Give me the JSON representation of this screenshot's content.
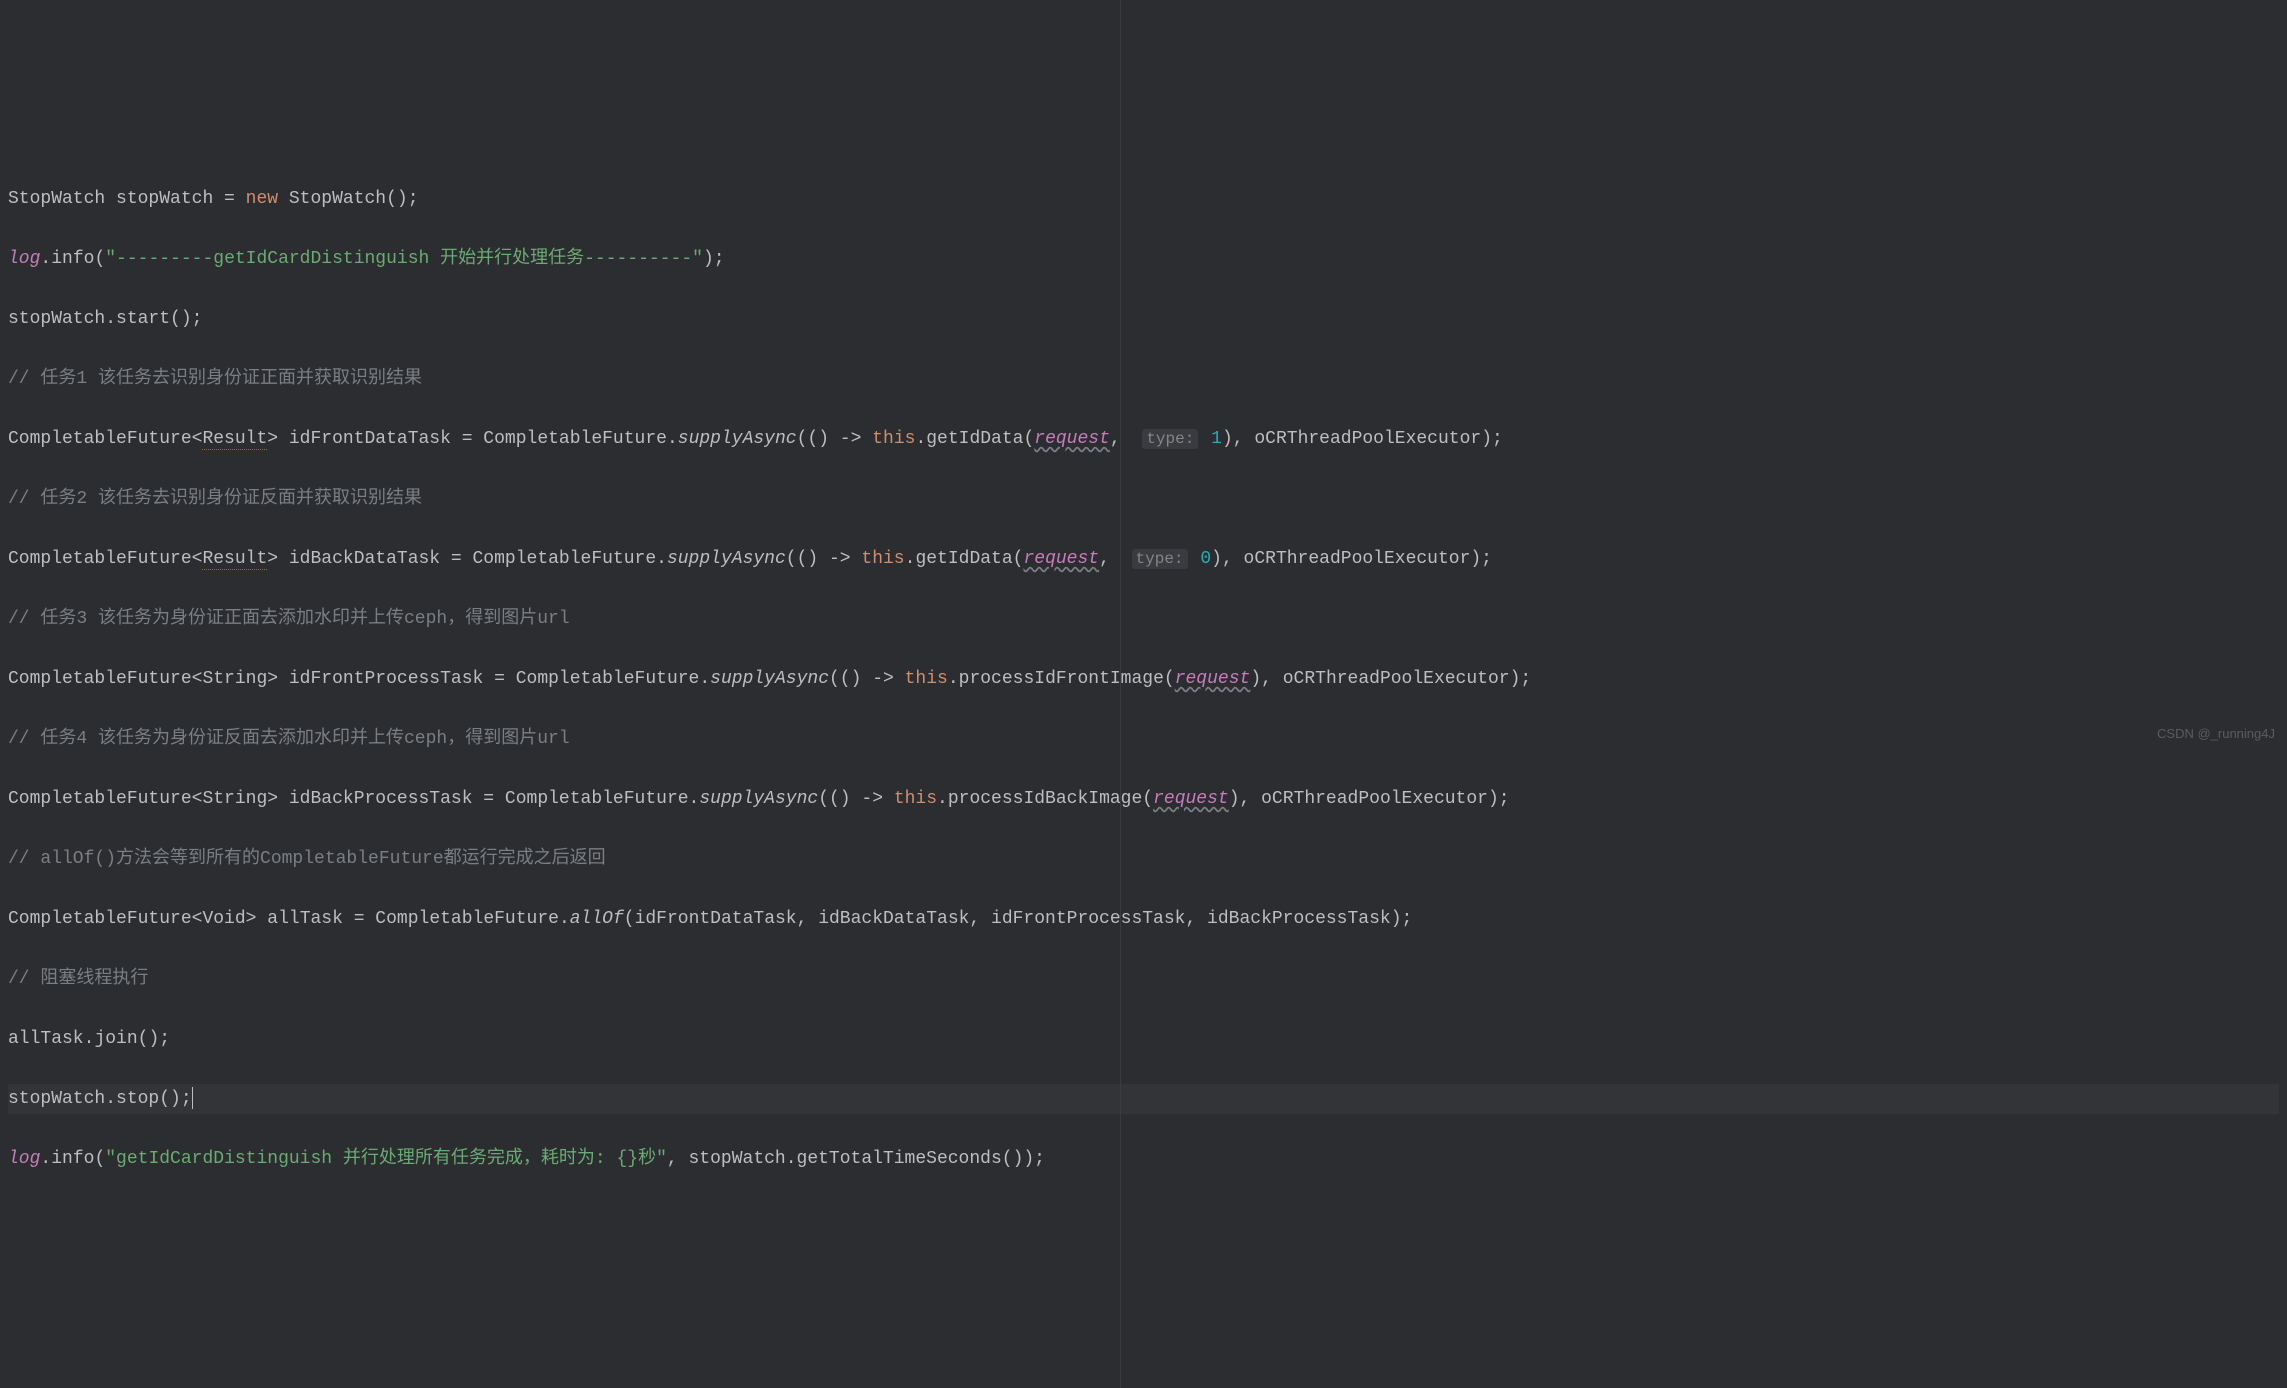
{
  "lines": {
    "l1": {
      "type1": "StopWatch",
      "var1": "stopWatch",
      "eq": " = ",
      "new": "new",
      "ctor": " StopWatch",
      "parens": "();"
    },
    "l2": {
      "log": "log",
      "dot": ".",
      "method": "info",
      "open": "(",
      "str": "\"---------getIdCardDistinguish 开始并行处理任务----------\"",
      "close": ");"
    },
    "l3": {
      "obj": "stopWatch",
      "dot": ".",
      "method": "start",
      "parens": "();"
    },
    "l4": {
      "comment": "// 任务1 该任务去识别身份证正面并获取识别结果"
    },
    "l5": {
      "type": "CompletableFuture",
      "lt": "<",
      "generic": "Result",
      "gt": ">",
      "var": " idFrontDataTask = CompletableFuture",
      "dot1": ".",
      "supply": "supplyAsync",
      "open": "(() -> ",
      "this": "this",
      "dot2": ".",
      "method": "getIdData",
      "open2": "(",
      "request": "request",
      "comma": ", ",
      "hint": "type:",
      "num": " 1",
      "close": "), oCRThreadPoolExecutor);"
    },
    "l6": {
      "comment": "// 任务2 该任务去识别身份证反面并获取识别结果"
    },
    "l7": {
      "type": "CompletableFuture",
      "lt": "<",
      "generic": "Result",
      "gt": ">",
      "var": " idBackDataTask = CompletableFuture",
      "dot1": ".",
      "supply": "supplyAsync",
      "open": "(() -> ",
      "this": "this",
      "dot2": ".",
      "method": "getIdData",
      "open2": "(",
      "request": "request",
      "comma": ", ",
      "hint": "type:",
      "num": " 0",
      "close": "), oCRThreadPoolExecutor);"
    },
    "l8": {
      "comment": "// 任务3 该任务为身份证正面去添加水印并上传ceph，得到图片url"
    },
    "l9": {
      "type": "CompletableFuture",
      "lt": "<",
      "generic": "String",
      "gt": ">",
      "var": " idFrontProcessTask = CompletableFuture",
      "dot1": ".",
      "supply": "supplyAsync",
      "open": "(() -> ",
      "this": "this",
      "dot2": ".",
      "method": "processIdFrontImage",
      "open2": "(",
      "request": "request",
      "close": "), oCRThreadPoolExecutor);"
    },
    "l10": {
      "comment": "// 任务4 该任务为身份证反面去添加水印并上传ceph，得到图片url"
    },
    "l11": {
      "type": "CompletableFuture",
      "lt": "<",
      "generic": "String",
      "gt": ">",
      "var": " idBackProcessTask = CompletableFuture",
      "dot1": ".",
      "supply": "supplyAsync",
      "open": "(() -> ",
      "this": "this",
      "dot2": ".",
      "method": "processIdBackImage",
      "open2": "(",
      "request": "request",
      "close": "), oCRThreadPoolExecutor);"
    },
    "l12": {
      "comment": "// allOf()方法会等到所有的CompletableFuture都运行完成之后返回"
    },
    "l13": {
      "type": "CompletableFuture",
      "lt": "<",
      "generic": "Void",
      "gt": ">",
      "var": " allTask = CompletableFuture",
      "dot1": ".",
      "allof": "allOf",
      "args": "(idFrontDataTask, idBackDataTask, idFrontProcessTask, idBackProcessTask);"
    },
    "l14": {
      "comment": "// 阻塞线程执行"
    },
    "l15": {
      "obj": "allTask",
      "dot": ".",
      "method": "join",
      "parens": "();"
    },
    "l16": {
      "obj": "stopWatch",
      "dot": ".",
      "method": "stop",
      "parens": "();"
    },
    "l17": {
      "log": "log",
      "dot": ".",
      "method": "info",
      "open": "(",
      "str": "\"getIdCardDistinguish 并行处理所有任务完成，耗时为: {}秒\"",
      "mid": ", stopWatch.getTotalTimeSeconds());"
    }
  },
  "watermark": "CSDN @_running4J"
}
